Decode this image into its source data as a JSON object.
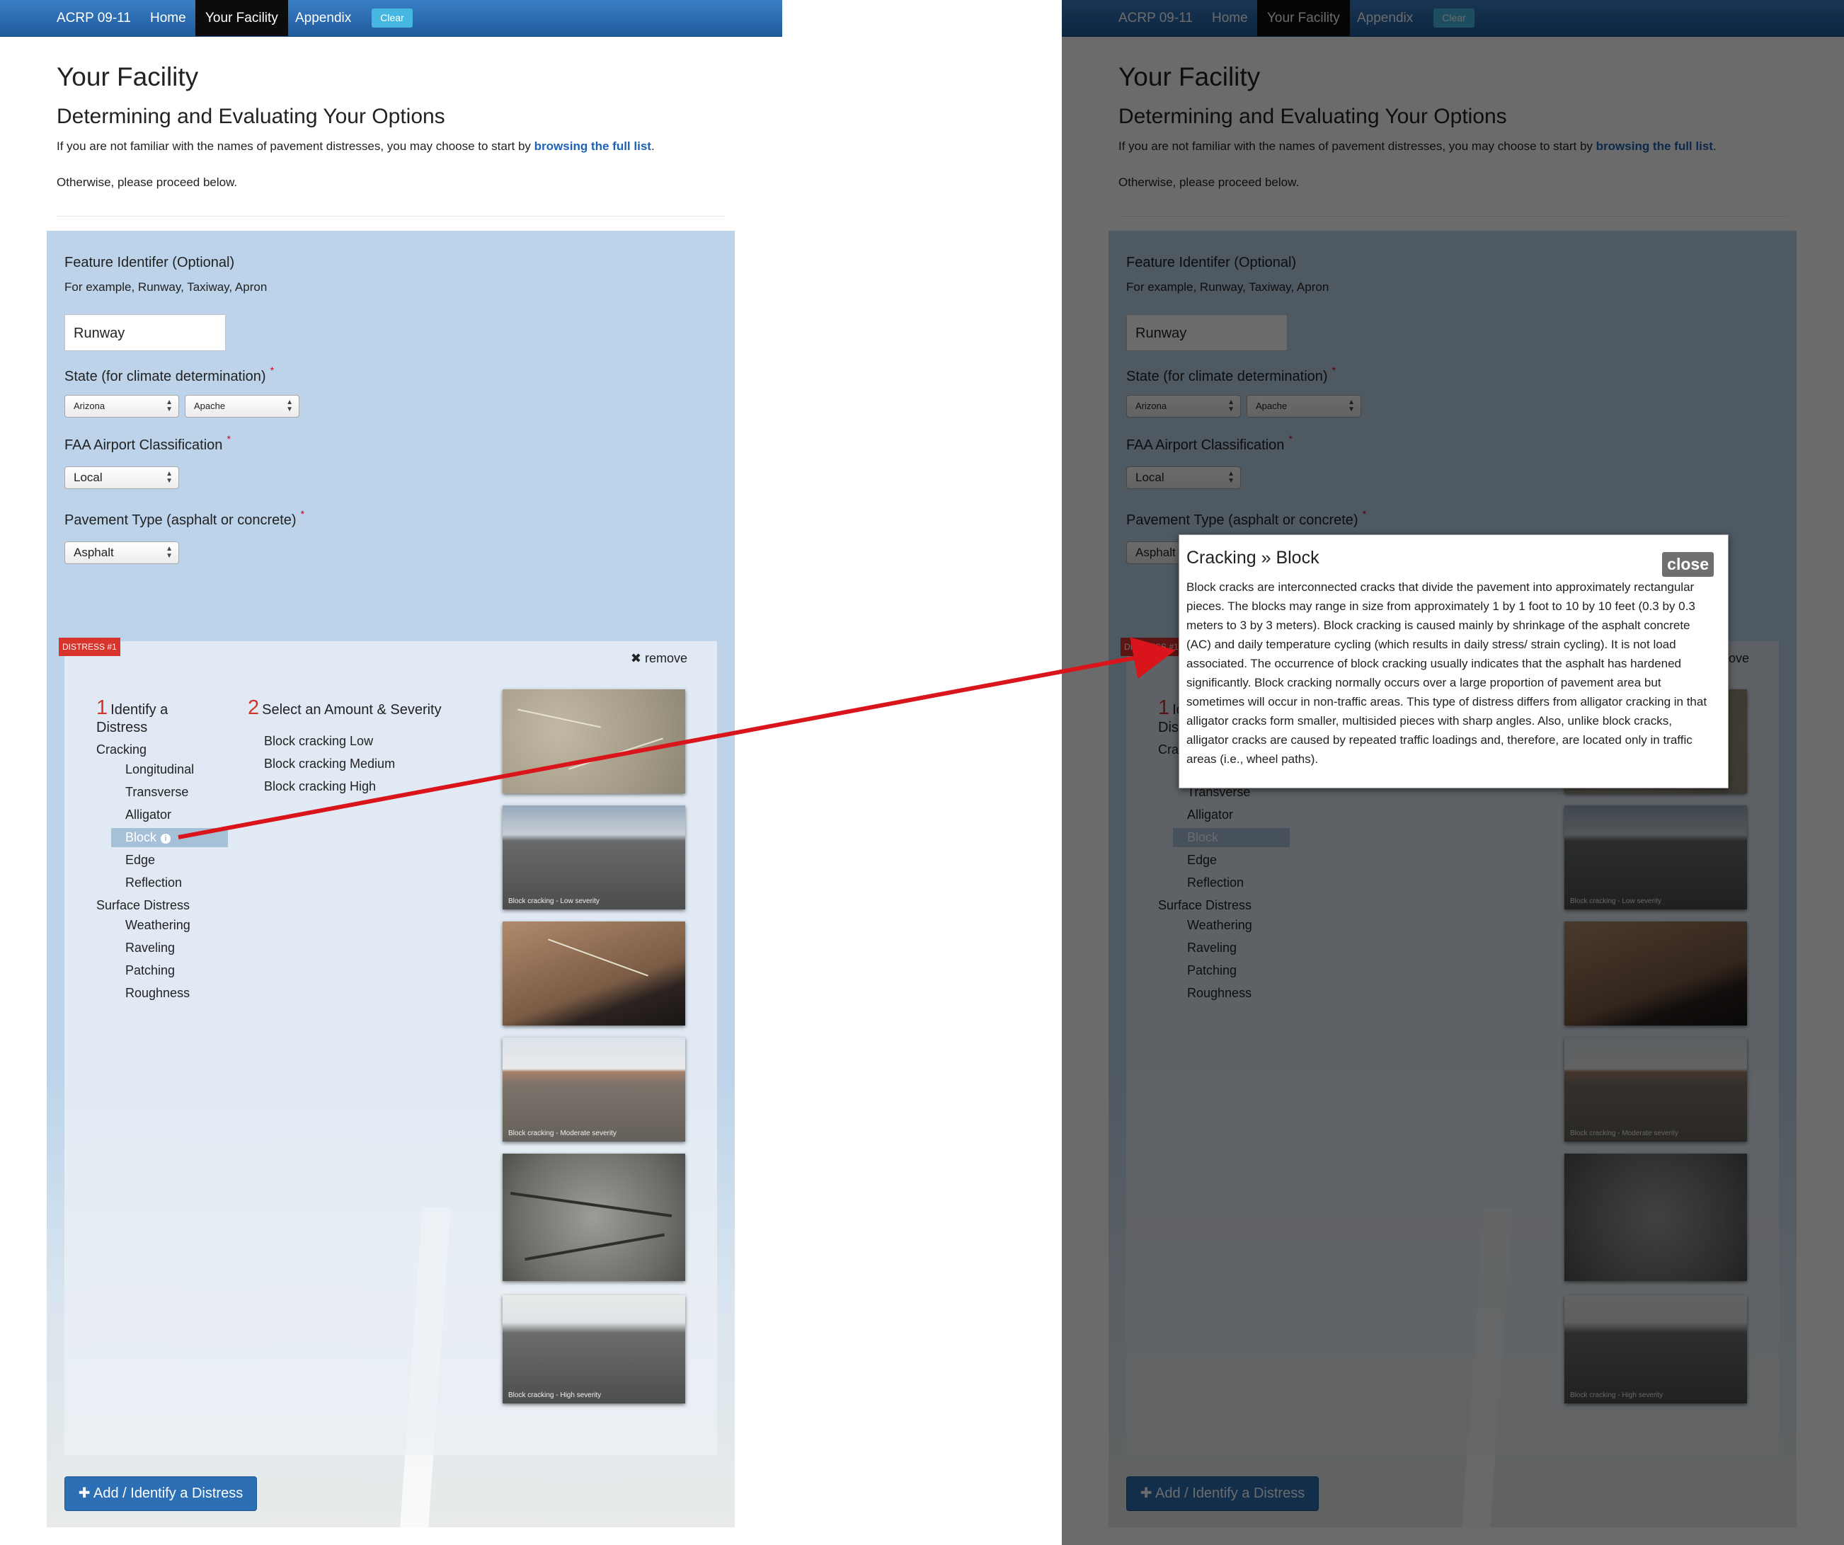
{
  "nav": {
    "brand": "ACRP 09-11",
    "home": "Home",
    "your_facility": "Your Facility",
    "appendix": "Appendix",
    "clear": "Clear"
  },
  "page": {
    "title": "Your Facility",
    "subtitle": "Determining and Evaluating Your Options",
    "intro_prefix": "If you are not familiar with the names of pavement distresses, you may choose to start by ",
    "intro_link": "browsing the full list",
    "intro_suffix": ".",
    "proceed": "Otherwise, please proceed below."
  },
  "form": {
    "feature_label": "Feature Identifer (Optional)",
    "feature_help": "For example, Runway, Taxiway, Apron",
    "feature_value": "Runway",
    "state_label": "State (for climate determination)",
    "state_value": "Arizona",
    "county_value": "Apache",
    "faa_label": "FAA Airport Classification",
    "faa_value": "Local",
    "pavement_label": "Pavement Type (asphalt or concrete)",
    "pavement_value": "Asphalt",
    "required_mark": "*"
  },
  "distress": {
    "badge": "DISTRESS #1",
    "remove": "remove",
    "step1_num": "1",
    "step1_line1": "Identify a",
    "step1_line2": "Distress",
    "step2_num": "2",
    "step2_label": "Select an Amount & Severity",
    "categories": [
      {
        "name": "Cracking",
        "items": [
          "Longitudinal",
          "Transverse",
          "Alligator",
          "Block",
          "Edge",
          "Reflection"
        ]
      },
      {
        "name": "Surface Distress",
        "items": [
          "Weathering",
          "Raveling",
          "Patching",
          "Roughness"
        ]
      }
    ],
    "selected": "Block",
    "severities": [
      "Block cracking Low",
      "Block cracking Medium",
      "Block cracking High"
    ],
    "thumb_captions": [
      "",
      "Block cracking - Low severity",
      "",
      "Block cracking - Moderate severity",
      "",
      "Block cracking - High severity"
    ]
  },
  "add_button": "Add / Identify a Distress",
  "modal": {
    "title": "Cracking » Block",
    "close": "close",
    "body": "Block cracks are interconnected cracks that divide the pavement into approximately rectangular pieces. The blocks may range in size from approximately 1 by 1 foot to 10 by 10 feet (0.3 by 0.3 meters to 3 by 3 meters). Block cracking is caused mainly by shrinkage of the asphalt concrete (AC) and daily temperature cycling (which results in daily stress/ strain cycling). It is not load associated. The occurrence of block cracking usually indicates that the asphalt has hardened significantly. Block cracking normally occurs over a large proportion of pavement area but sometimes will occur in non-traffic areas. This type of distress differs from alligator cracking in that alligator cracks form smaller, multisided pieces with sharp angles. Also, unlike block cracks, alligator cracks are caused by repeated traffic loadings and, therefore, are located only in traffic areas (i.e., wheel paths)."
  },
  "colors": {
    "navbar": "#2a6bb0",
    "panel": "#bcd3ea",
    "badge": "#d9342b",
    "arrow": "#d9141a",
    "button": "#2c6fb4"
  }
}
